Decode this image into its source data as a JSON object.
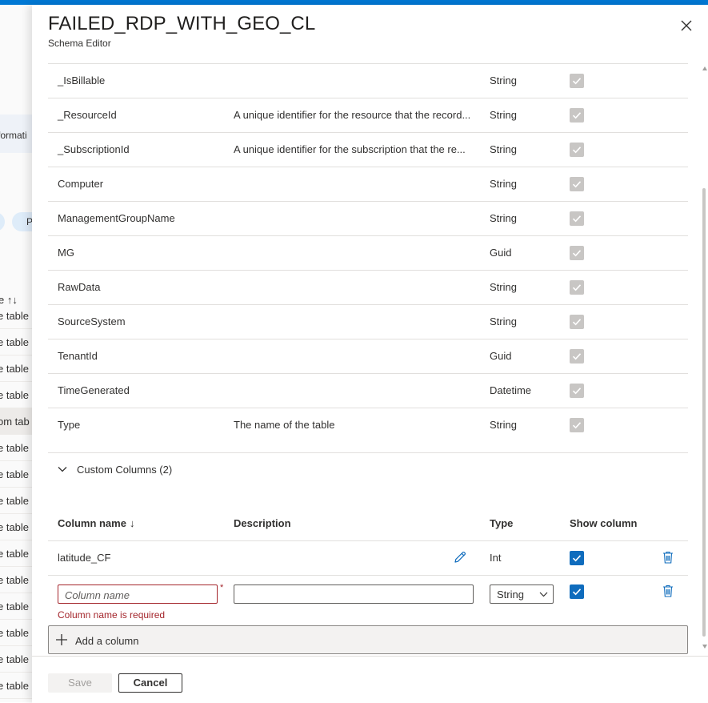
{
  "background_page": {
    "info_text": "formati",
    "pill_text": "P",
    "sort_label": "e ↑↓",
    "rows": [
      "e table",
      "e table",
      "e table",
      "e table",
      "om tab",
      "e table",
      "e table",
      "e table",
      "e table",
      "e table",
      "e table",
      "e table",
      "e table",
      "e table",
      "e table"
    ]
  },
  "panel": {
    "title": "FAILED_RDP_WITH_GEO_CL",
    "subtitle": "Schema Editor",
    "close_icon": "close-icon"
  },
  "standard_columns": [
    {
      "name": "_IsBillable",
      "description": "",
      "type": "String",
      "show": true
    },
    {
      "name": "_ResourceId",
      "description": "A unique identifier for the resource that the record...",
      "type": "String",
      "show": true
    },
    {
      "name": "_SubscriptionId",
      "description": "A unique identifier for the subscription that the re...",
      "type": "String",
      "show": true
    },
    {
      "name": "Computer",
      "description": "",
      "type": "String",
      "show": true
    },
    {
      "name": "ManagementGroupName",
      "description": "",
      "type": "String",
      "show": true
    },
    {
      "name": "MG",
      "description": "",
      "type": "Guid",
      "show": true
    },
    {
      "name": "RawData",
      "description": "",
      "type": "String",
      "show": true
    },
    {
      "name": "SourceSystem",
      "description": "",
      "type": "String",
      "show": true
    },
    {
      "name": "TenantId",
      "description": "",
      "type": "Guid",
      "show": true
    },
    {
      "name": "TimeGenerated",
      "description": "",
      "type": "Datetime",
      "show": true
    },
    {
      "name": "Type",
      "description": "The name of the table",
      "type": "String",
      "show": true
    }
  ],
  "custom_section": {
    "label": "Custom Columns (2)",
    "headers": {
      "column_name": "Column name",
      "sort_indicator": "↓",
      "description": "Description",
      "type": "Type",
      "show_column": "Show column"
    },
    "rows": [
      {
        "name": "latitude_CF",
        "type": "Int",
        "show": true
      }
    ],
    "new_row": {
      "name_placeholder": "Column name",
      "required_marker": "*",
      "error": "Column name is required",
      "description_value": "",
      "type_selected": "String",
      "show": true
    },
    "add_label": "Add a column"
  },
  "footer": {
    "save_label": "Save",
    "cancel_label": "Cancel"
  },
  "colors": {
    "accent": "#0078d4",
    "checkbox_on": "#0f6cbd",
    "checkbox_disabled": "#c8c6c4",
    "error": "#a4262c"
  }
}
